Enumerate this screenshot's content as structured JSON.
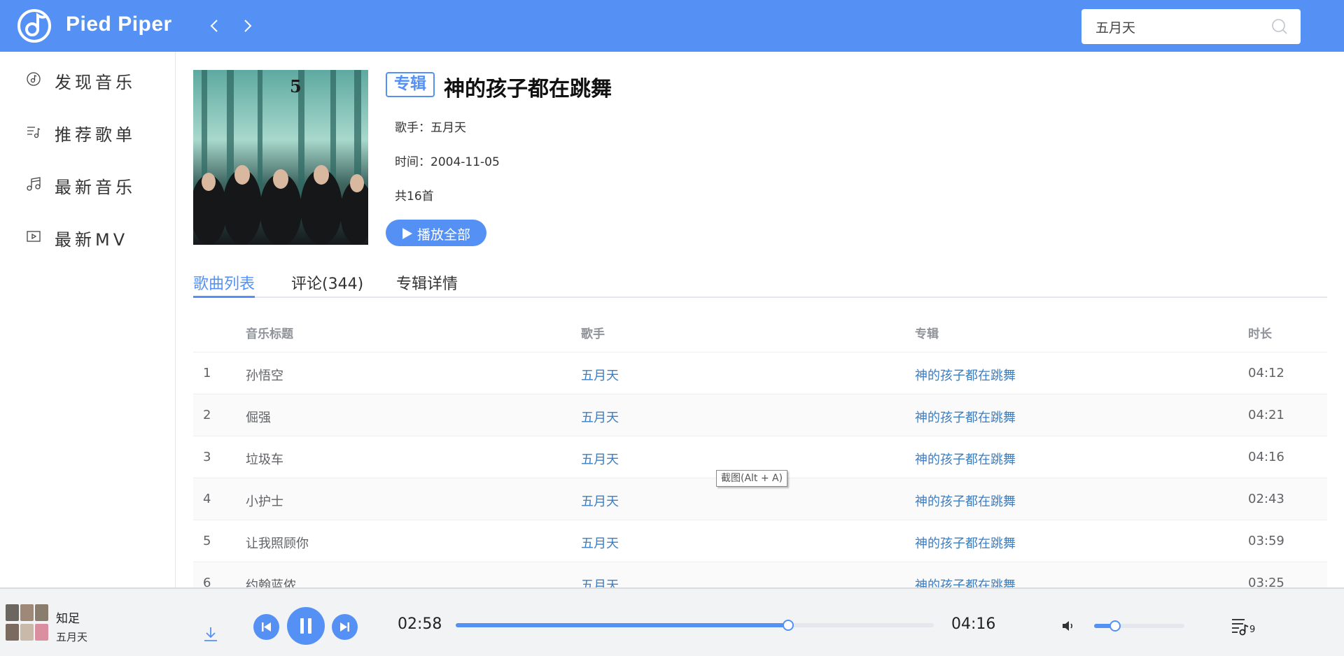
{
  "app": {
    "name": "Pied Piper"
  },
  "search": {
    "value": "五月天",
    "placeholder": ""
  },
  "sidebar": {
    "items": [
      {
        "label": "发现音乐",
        "icon": "disc-icon"
      },
      {
        "label": "推荐歌单",
        "icon": "playlist-icon"
      },
      {
        "label": "最新音乐",
        "icon": "music-note-icon"
      },
      {
        "label": "最新MV",
        "icon": "video-icon"
      }
    ]
  },
  "album": {
    "tag": "专辑",
    "title": "神的孩子都在跳舞",
    "artist_line": "歌手：五月天",
    "time_line": "时间：2004-11-05",
    "count_line": "共16首",
    "play_all_label": "播放全部",
    "cover_caption_mark": "5",
    "cover_caption_title": "神的孩子都在跳舞"
  },
  "tabs": [
    {
      "label": "歌曲列表",
      "active": true
    },
    {
      "label": "评论(344)",
      "active": false
    },
    {
      "label": "专辑详情",
      "active": false
    }
  ],
  "table": {
    "columns": [
      "音乐标题",
      "歌手",
      "专辑",
      "时长"
    ],
    "rows": [
      {
        "index": "1",
        "title": "孙悟空",
        "artist": "五月天",
        "album": "神的孩子都在跳舞",
        "duration": "04:12"
      },
      {
        "index": "2",
        "title": "倔强",
        "artist": "五月天",
        "album": "神的孩子都在跳舞",
        "duration": "04:21"
      },
      {
        "index": "3",
        "title": "垃圾车",
        "artist": "五月天",
        "album": "神的孩子都在跳舞",
        "duration": "04:16"
      },
      {
        "index": "4",
        "title": "小护士",
        "artist": "五月天",
        "album": "神的孩子都在跳舞",
        "duration": "02:43"
      },
      {
        "index": "5",
        "title": "让我照顾你",
        "artist": "五月天",
        "album": "神的孩子都在跳舞",
        "duration": "03:59"
      },
      {
        "index": "6",
        "title": "约翰蓝侬",
        "artist": "五月天",
        "album": "神的孩子都在跳舞",
        "duration": "03:25"
      }
    ]
  },
  "tooltip": {
    "text": "截图(Alt + A)"
  },
  "player": {
    "song": "知足",
    "artist": "五月天",
    "current_time": "02:58",
    "total_time": "04:16",
    "progress": 0.695,
    "volume": 0.23,
    "playlist_count": "9",
    "state": "playing"
  },
  "colors": {
    "accent": "#5591f5",
    "link": "#3a7ec4",
    "header_bg": "#5591f5",
    "player_bg": "#f1f3f4"
  }
}
